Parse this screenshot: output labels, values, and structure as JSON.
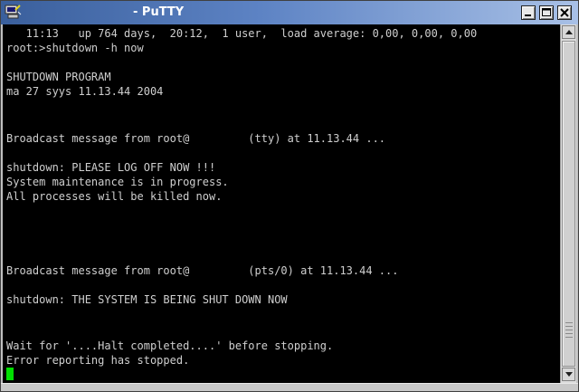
{
  "window": {
    "title": "- PuTTY",
    "icon": "putty-computer-icon",
    "controls": {
      "minimize_icon": "minimize-icon",
      "maximize_icon": "maximize-icon",
      "close_icon": "close-icon"
    }
  },
  "terminal": {
    "lines": [
      "   11:13   up 764 days,  20:12,  1 user,  load average: 0,00, 0,00, 0,00",
      "root:>shutdown -h now",
      "",
      "SHUTDOWN PROGRAM",
      "ma 27 syys 11.13.44 2004",
      "",
      "",
      "Broadcast message from root@         (tty) at 11.13.44 ...",
      "",
      "shutdown: PLEASE LOG OFF NOW !!!",
      "System maintenance is in progress.",
      "All processes will be killed now.",
      "",
      "",
      "",
      "",
      "Broadcast message from root@         (pts/0) at 11.13.44 ...",
      "",
      "shutdown: THE SYSTEM IS BEING SHUT DOWN NOW",
      "",
      "",
      "Wait for '....Halt completed....' before stopping.",
      "Error reporting has stopped."
    ]
  },
  "colors": {
    "terminal_bg": "#000000",
    "terminal_fg": "#cfcfcf",
    "cursor": "#00e000",
    "titlebar_start": "#3a5f9c",
    "titlebar_end": "#a8c0e6"
  }
}
